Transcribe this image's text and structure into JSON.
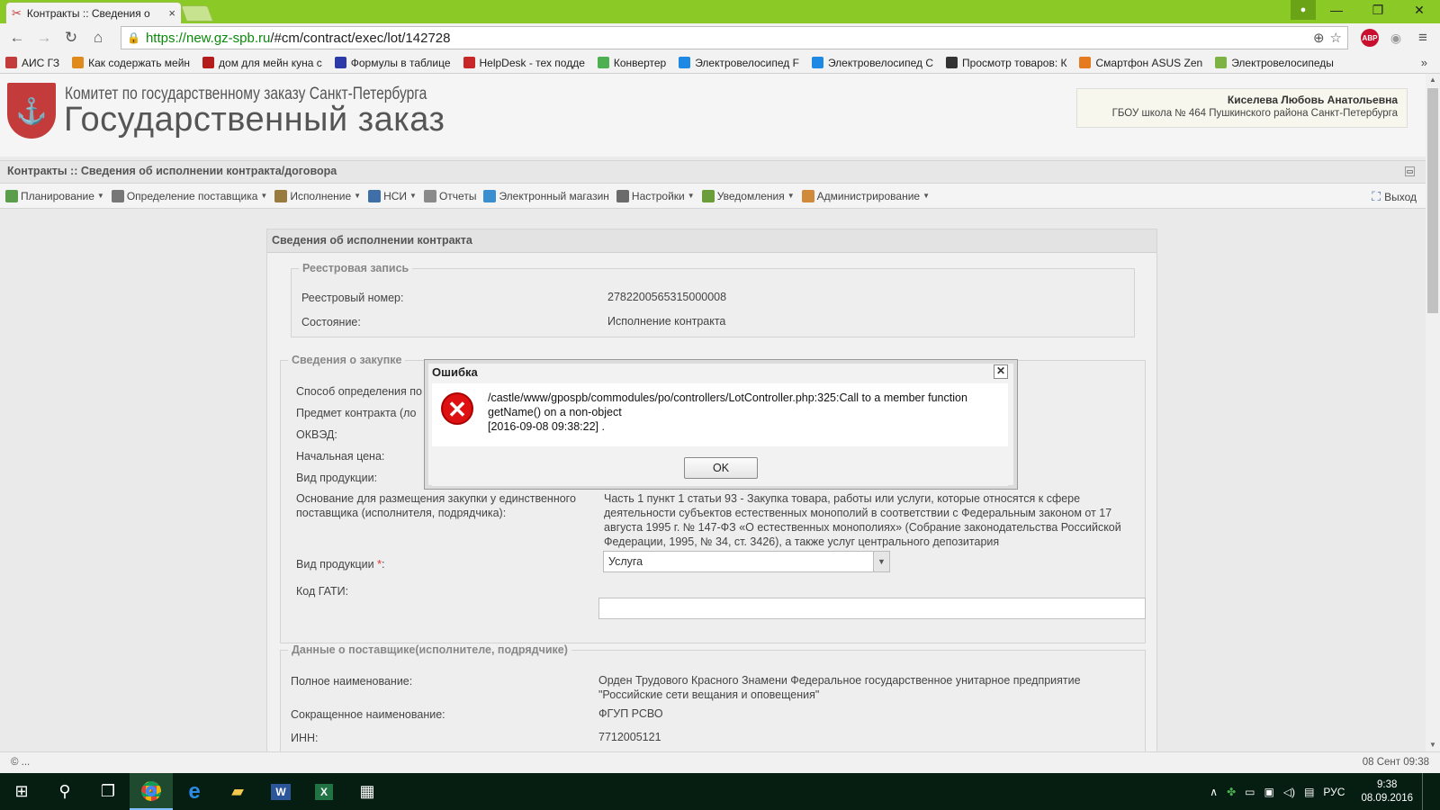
{
  "browser": {
    "tab_title": "Контракты :: Сведения о",
    "tab_close": "×",
    "url_host": "https://new.gz-spb.ru",
    "url_path": "/#cm/contract/exec/lot/142728",
    "ext_abp": "ABP",
    "bookmarks": [
      {
        "label": "АИС ГЗ",
        "color": "#c43b3b"
      },
      {
        "label": "Как содержать мейн",
        "color": "#e08a1e"
      },
      {
        "label": "дом для мейн куна с",
        "color": "#b51c1c"
      },
      {
        "label": "Формулы в таблице",
        "color": "#2b3aa8"
      },
      {
        "label": "HelpDesk - тех подде",
        "color": "#c82727"
      },
      {
        "label": "Конвертер",
        "color": "#4caf50"
      },
      {
        "label": "Электровелосипед F",
        "color": "#1e88e5"
      },
      {
        "label": "Электровелосипед С",
        "color": "#1e88e5"
      },
      {
        "label": "Просмотр товаров: К",
        "color": "#333333"
      },
      {
        "label": "Смартфон ASUS Zen",
        "color": "#e57a1e"
      },
      {
        "label": "Электровелосипеды",
        "color": "#7cb342"
      }
    ],
    "bookmarks_more": "»"
  },
  "header": {
    "logo_line1": "Комитет по государственному заказу Санкт-Петербурга",
    "logo_line2": "Государственный заказ",
    "user_name": "Киселева Любовь Анатольевна",
    "user_org": "ГБОУ школа № 464 Пушкинского района Санкт-Петербурга"
  },
  "breadcrumb": "Контракты :: Сведения об исполнении контракта/договора",
  "menu": [
    {
      "label": "Планирование",
      "color": "#5a9e4b",
      "dropdown": true
    },
    {
      "label": "Определение поставщика",
      "color": "#777777",
      "dropdown": true
    },
    {
      "label": "Исполнение",
      "color": "#9a7b3f",
      "dropdown": true
    },
    {
      "label": "НСИ",
      "color": "#3f6fa8",
      "dropdown": true
    },
    {
      "label": "Отчеты",
      "color": "#8a8a8a",
      "dropdown": false
    },
    {
      "label": "Электронный магазин",
      "color": "#3a8fd0",
      "dropdown": false
    },
    {
      "label": "Настройки",
      "color": "#6b6b6b",
      "dropdown": true
    },
    {
      "label": "Уведомления",
      "color": "#6b9e3a",
      "dropdown": true
    },
    {
      "label": "Администрирование",
      "color": "#d08a3a",
      "dropdown": true
    }
  ],
  "logout": "Выход",
  "panel": {
    "title": "Сведения об исполнении контракта",
    "registry": {
      "legend": "Реестровая запись",
      "reg_number_label": "Реестровый номер:",
      "reg_number": "2782200565315000008",
      "state_label": "Состояние:",
      "state": "Исполнение контракта"
    },
    "purchase": {
      "legend": "Сведения о закупке",
      "method_label": "Способ определения по",
      "subject_label": "Предмет контракта (ло",
      "okved_label": "ОКВЭД:",
      "price_label": "Начальная цена:",
      "product_type_label": "Вид продукции:",
      "basis_label": "Основание для размещения закупки у единственного поставщика (исполнителя, подрядчика):",
      "basis_text": "Часть 1 пункт 1 статьи 93 - Закупка товара, работы или услуги, которые относятся к сфере деятельности субъектов естественных монополий в соответствии с Федеральным законом от 17 августа 1995 г. № 147-ФЗ «О естественных монополиях» (Собрание законодательства Российской Федерации, 1995, № 34, ст. 3426), а также услуг центрального депозитария",
      "product_type2_label": "Вид продукции",
      "product_type2_value": "Услуга",
      "gati_label": "Код ГАТИ:"
    },
    "supplier": {
      "legend": "Данные о поставщике(исполнителе, подрядчике)",
      "full_name_label": "Полное наименование:",
      "full_name": "Орден Трудового Красного Знамени Федеральное государственное унитарное предприятие \"Российские сети вещания и оповещения\"",
      "short_name_label": "Сокращенное наименование:",
      "short_name": "ФГУП РСВО",
      "inn_label": "ИНН:",
      "inn": "7712005121"
    }
  },
  "dialog": {
    "title": "Ошибка",
    "message": "/castle/www/gpospb/commodules/po/controllers/LotController.php:325:Call to a member function getName() on a non-object",
    "timestamp": "[2016-09-08 09:38:22] .",
    "ok_label": "OK"
  },
  "statusbar": {
    "left": "© ...",
    "right": "08 Сент 09:38"
  },
  "taskbar": {
    "lang": "РУС",
    "time": "9:38",
    "date": "08.09.2016"
  }
}
